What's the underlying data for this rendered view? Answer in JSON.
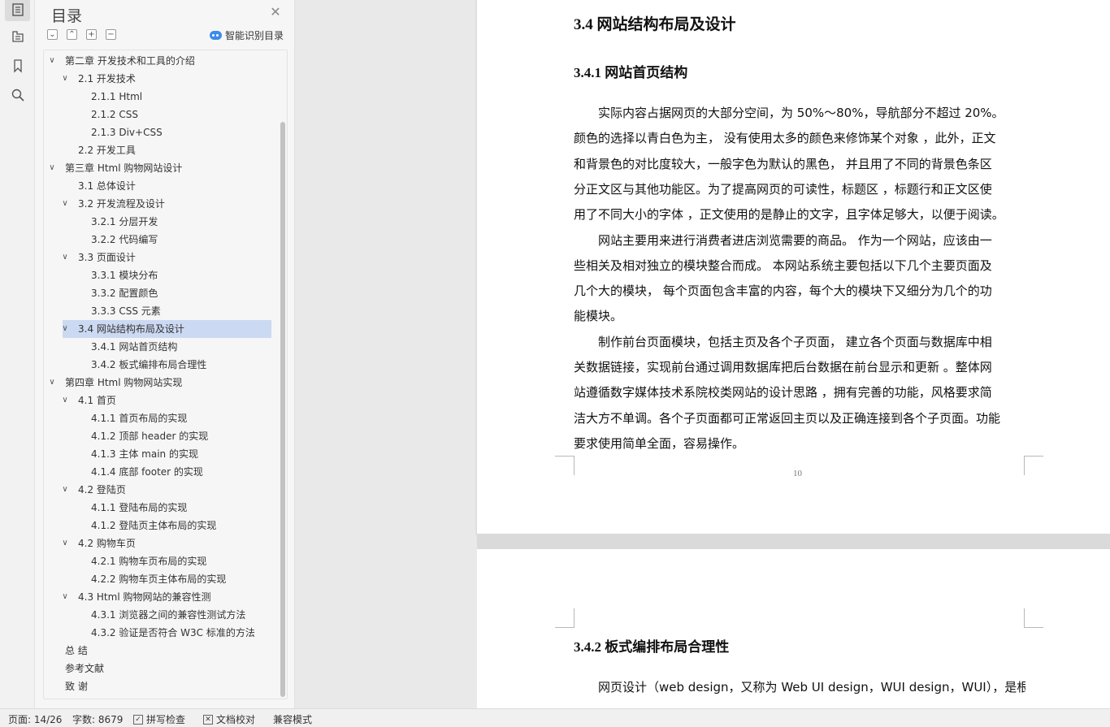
{
  "rail": {
    "icons": [
      "toc-icon",
      "navigation-pane-icon",
      "bookmark-icon",
      "search-icon"
    ]
  },
  "toc_panel": {
    "title": "目录",
    "smart_label": "智能识别目录",
    "items": [
      {
        "label": "第二章  开发技术和工具的介绍",
        "level": 1,
        "chev": "v"
      },
      {
        "label": "2.1 开发技术",
        "level": 2,
        "chev": "v"
      },
      {
        "label": "2.1.1 Html",
        "level": 3,
        "chev": ""
      },
      {
        "label": "2.1.2 CSS",
        "level": 3,
        "chev": ""
      },
      {
        "label": "2.1.3 Div+CSS",
        "level": 3,
        "chev": ""
      },
      {
        "label": "2.2 开发工具",
        "level": 2,
        "chev": ""
      },
      {
        "label": "第三章  Html 购物网站设计",
        "level": 1,
        "chev": "v"
      },
      {
        "label": "3.1 总体设计",
        "level": 2,
        "chev": ""
      },
      {
        "label": "3.2 开发流程及设计",
        "level": 2,
        "chev": "v"
      },
      {
        "label": "3.2.1  分层开发",
        "level": 3,
        "chev": ""
      },
      {
        "label": "3.2.2  代码编写",
        "level": 3,
        "chev": ""
      },
      {
        "label": "3.3 页面设计",
        "level": 2,
        "chev": "v"
      },
      {
        "label": "3.3.1 模块分布",
        "level": 3,
        "chev": ""
      },
      {
        "label": "3.3.2  配置颜色",
        "level": 3,
        "chev": ""
      },
      {
        "label": "3.3.3 CSS 元素",
        "level": 3,
        "chev": ""
      },
      {
        "label": "3.4 网站结构布局及设计",
        "level": 2,
        "chev": "v",
        "active": true
      },
      {
        "label": "3.4.1  网站首页结构",
        "level": 3,
        "chev": ""
      },
      {
        "label": "3.4.2  板式编排布局合理性",
        "level": 3,
        "chev": ""
      },
      {
        "label": "第四章  Html 购物网站实现",
        "level": 1,
        "chev": "v"
      },
      {
        "label": "4.1 首页",
        "level": 2,
        "chev": "v"
      },
      {
        "label": "4.1.1 首页布局的实现",
        "level": 3,
        "chev": ""
      },
      {
        "label": "4.1.2  顶部 header 的实现",
        "level": 3,
        "chev": ""
      },
      {
        "label": "4.1.3  主体 main 的实现",
        "level": 3,
        "chev": ""
      },
      {
        "label": "4.1.4  底部 footer 的实现",
        "level": 3,
        "chev": ""
      },
      {
        "label": "4.2  登陆页",
        "level": 2,
        "chev": "v"
      },
      {
        "label": "4.1.1 登陆布局的实现",
        "level": 3,
        "chev": ""
      },
      {
        "label": "4.1.2 登陆页主体布局的实现",
        "level": 3,
        "chev": ""
      },
      {
        "label": "4.2  购物车页",
        "level": 2,
        "chev": "v"
      },
      {
        "label": "4.2.1 购物车页布局的实现",
        "level": 3,
        "chev": ""
      },
      {
        "label": "4.2.2 购物车页主体布局的实现",
        "level": 3,
        "chev": ""
      },
      {
        "label": "4.3 Html 购物网站的兼容性测",
        "level": 2,
        "chev": "v"
      },
      {
        "label": "4.3.1 浏览器之间的兼容性测试方法",
        "level": 3,
        "chev": ""
      },
      {
        "label": "4.3.2 验证是否符合 W3C 标准的方法",
        "level": 3,
        "chev": ""
      },
      {
        "label": "总    结",
        "level": 1,
        "chev": ""
      },
      {
        "label": "参考文献",
        "level": 1,
        "chev": ""
      },
      {
        "label": "致    谢",
        "level": 1,
        "chev": ""
      }
    ]
  },
  "document": {
    "heading_34": "3.4 网站结构布局及设计",
    "heading_341": "3.4.1  网站首页结构",
    "para_lines": [
      "　　实际内容占据网页的大部分空间，为 50%～80%，导航部分不超过 20%。",
      "颜色的选择以青白色为主， 没有使用太多的颜色来修饰某个对象 ，此外，正文",
      "和背景色的对比度较大，一般字色为默认的黑色， 并且用了不同的背景色条区",
      "分正文区与其他功能区。为了提高网页的可读性，标题区 ，标题行和正文区使",
      "用了不同大小的字体 ，正文使用的是静止的文字，且字体足够大，以便于阅读。",
      "　　网站主要用来进行消费者进店浏览需要的商品。 作为一个网站，应该由一",
      "些相关及相对独立的模块整合而成。 本网站系统主要包括以下几个主要页面及",
      "几个大的模块， 每个页面包含丰富的内容，每个大的模块下又细分为几个的功",
      "能模块。",
      "　　制作前台页面模块，包括主页及各个子页面， 建立各个页面与数据库中相",
      "关数据链接，实现前台通过调用数据库把后台数据在前台显示和更新 。整体网",
      "站遵循数字媒体技术系院校类网站的设计思路 ，拥有完善的功能，风格要求简",
      "洁大方不单调。各个子页面都可正常返回主页以及正确连接到各个子页面。功能",
      "要求使用简单全面，容易操作。"
    ],
    "page_number": "10",
    "heading_342": "3.4.2  板式编排布局合理性",
    "para2_line": "　　网页设计（web design，又称为 Web UI design，WUI design，WUI），是根"
  },
  "status_bar": {
    "page": "页面: 14/26",
    "words": "字数: 8679",
    "spell": "拼写检查",
    "proof": "文档校对",
    "compat": "兼容模式"
  }
}
